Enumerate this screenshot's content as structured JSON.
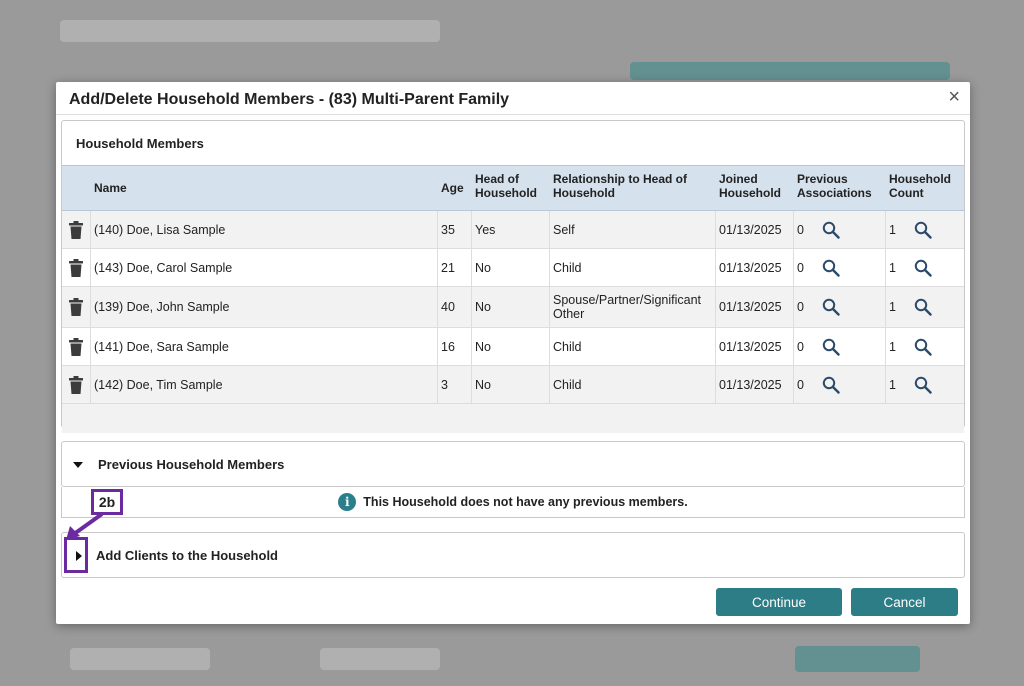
{
  "modal": {
    "title": "Add/Delete Household Members - (83) Multi-Parent Family",
    "close_label": "×"
  },
  "household_members": {
    "heading": "Household Members",
    "columns": {
      "name": "Name",
      "age": "Age",
      "head_of_household": "Head of Household",
      "relationship": "Relationship to Head of Household",
      "joined": "Joined Household",
      "previous_associations": "Previous Associations",
      "household_count": "Household Count"
    },
    "rows": [
      {
        "name": "(140) Doe, Lisa Sample",
        "age": "35",
        "head": "Yes",
        "relationship": "Self",
        "joined": "01/13/2025",
        "prev": "0",
        "count": "1"
      },
      {
        "name": "(143) Doe, Carol Sample",
        "age": "21",
        "head": "No",
        "relationship": "Child",
        "joined": "01/13/2025",
        "prev": "0",
        "count": "1"
      },
      {
        "name": "(139) Doe, John Sample",
        "age": "40",
        "head": "No",
        "relationship": "Spouse/Partner/Significant Other",
        "joined": "01/13/2025",
        "prev": "0",
        "count": "1"
      },
      {
        "name": "(141) Doe, Sara Sample",
        "age": "16",
        "head": "No",
        "relationship": "Child",
        "joined": "01/13/2025",
        "prev": "0",
        "count": "1"
      },
      {
        "name": "(142) Doe, Tim Sample",
        "age": "3",
        "head": "No",
        "relationship": "Child",
        "joined": "01/13/2025",
        "prev": "0",
        "count": "1"
      }
    ]
  },
  "previous_members": {
    "heading": "Previous Household Members",
    "message": "This Household does not have any previous members."
  },
  "add_clients": {
    "heading": "Add Clients to the Household"
  },
  "buttons": {
    "continue": "Continue",
    "cancel": "Cancel"
  },
  "annotation": {
    "callout": "2b"
  },
  "colors": {
    "accent": "#2d7d86",
    "header_bg": "#d5e1ec",
    "annotation": "#6b2aa0"
  }
}
